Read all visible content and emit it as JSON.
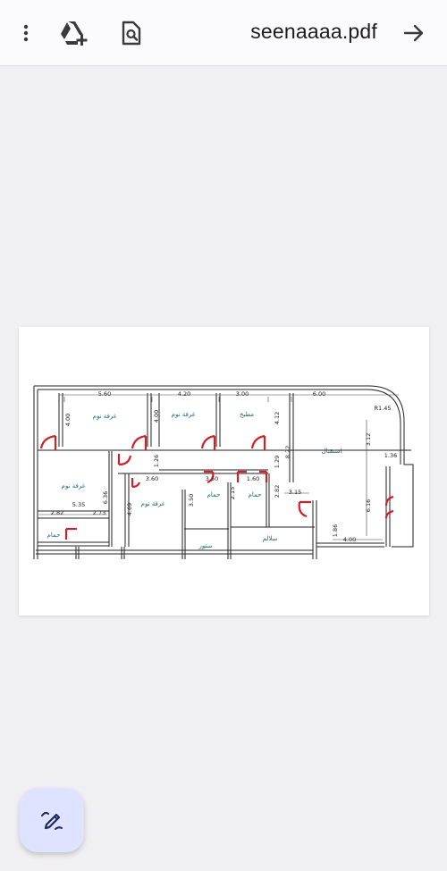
{
  "toolbar": {
    "title": "seenaaaa.pdf",
    "icons": [
      "more-vert-icon",
      "drive-add-icon",
      "find-in-page-icon",
      "arrow-forward-icon"
    ]
  },
  "plan": {
    "rooms": {
      "bed1": "غرفة نوم",
      "bed2": "غرفة نوم",
      "bed3": "غرفة نوم",
      "bed4": "غرفة نوم",
      "kitchen": "مطبخ",
      "reception": "استقبال",
      "bath1": "حمام",
      "bath2": "حمام",
      "bath3": "حمام",
      "closet": "ستور",
      "stairs": "سلالم"
    },
    "dims": {
      "d1": "5.60",
      "d2": "4.20",
      "d3": "3.00",
      "d4": "6.00",
      "d5": "R1.45",
      "d6": "4.00",
      "d7": "4.00",
      "d8": "4.12",
      "d9": "8.22",
      "d10": "3.12",
      "d11": "1.36",
      "d12": "1.26",
      "d13": "1.29",
      "d14": "3.60",
      "d15": "3.50",
      "d16": "1.60",
      "d17": "2.82",
      "d18": "3.15",
      "d19": "5.35",
      "d20": "6.36",
      "d21": "4.69",
      "d22": "3.50",
      "d23": "2.15",
      "d24": "2.82",
      "d25": "2.73",
      "d26": "1.86",
      "d27": "4.00",
      "d28": "6.16"
    }
  },
  "colors": {
    "accent": "#dfe3ff",
    "door": "#d0202a",
    "roomLabel": "#1a6b6b"
  }
}
